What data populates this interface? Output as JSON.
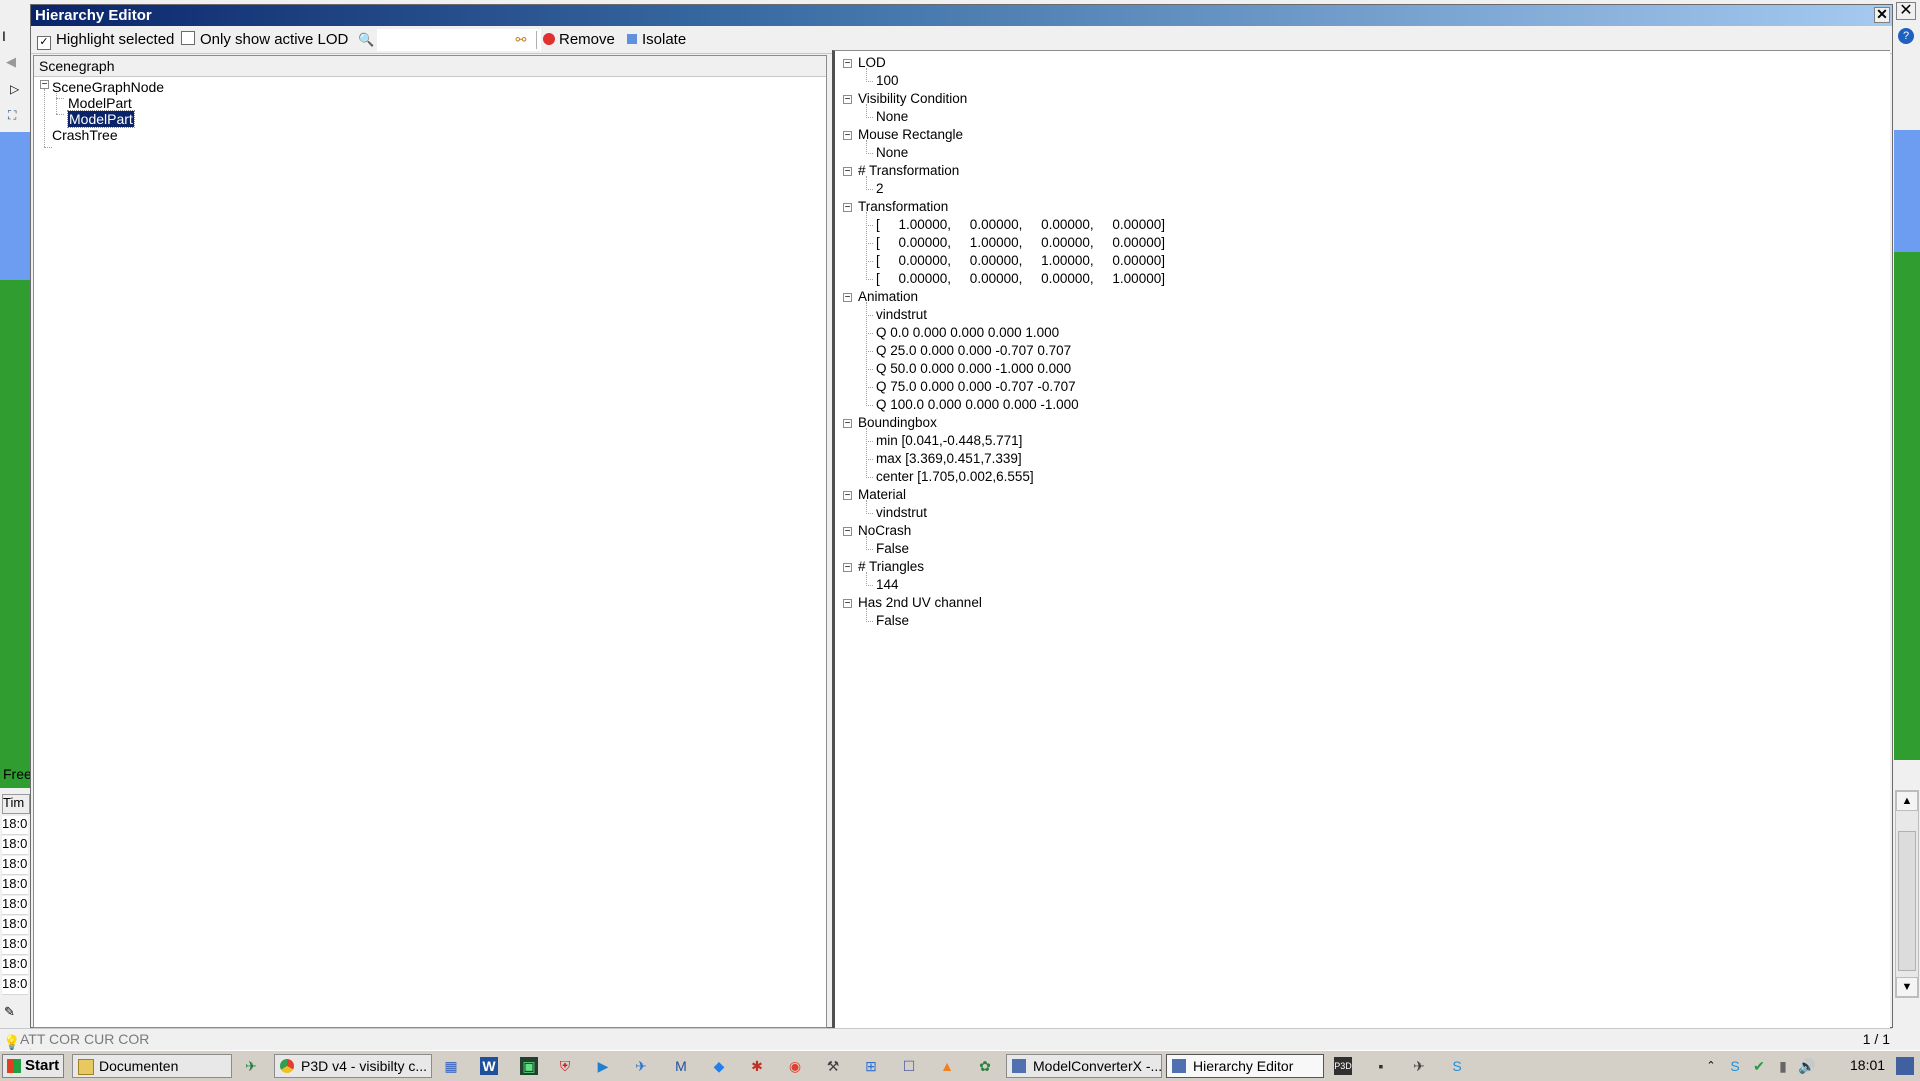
{
  "dialog": {
    "title": "Hierarchy Editor",
    "close_glyph": "✕"
  },
  "toolbar": {
    "highlight_selected": {
      "label": "Highlight selected",
      "checked": true
    },
    "only_active_lod": {
      "label": "Only show active LOD",
      "checked": false
    },
    "search_placeholder": "",
    "remove_label": "Remove",
    "isolate_label": "Isolate"
  },
  "scenegraph": {
    "header": "Scenegraph",
    "nodes": [
      {
        "label": "SceneGraphNode",
        "selected": false
      },
      {
        "label": "ModelPart",
        "selected": false
      },
      {
        "label": "ModelPart",
        "selected": true
      },
      {
        "label": "CrashTree",
        "selected": false
      }
    ]
  },
  "properties": [
    {
      "name": "LOD",
      "values": [
        "100"
      ]
    },
    {
      "name": "Visibility Condition",
      "values": [
        "None"
      ]
    },
    {
      "name": "Mouse Rectangle",
      "values": [
        "None"
      ]
    },
    {
      "name": "# Transformation",
      "values": [
        "2"
      ]
    },
    {
      "name": "Transformation",
      "values": [
        "[     1.00000,     0.00000,     0.00000,     0.00000]",
        "[     0.00000,     1.00000,     0.00000,     0.00000]",
        "[     0.00000,     0.00000,     1.00000,     0.00000]",
        "[     0.00000,     0.00000,     0.00000,     1.00000]"
      ]
    },
    {
      "name": "Animation",
      "values": [
        "vindstrut",
        "Q 0.0 0.000 0.000 0.000 1.000",
        "Q 25.0 0.000 0.000 -0.707 0.707",
        "Q 50.0 0.000 0.000 -1.000 0.000",
        "Q 75.0 0.000 0.000 -0.707 -0.707",
        "Q 100.0 0.000 0.000 0.000 -1.000"
      ]
    },
    {
      "name": "Boundingbox",
      "values": [
        "min [0.041,-0.448,5.771]",
        "max [3.369,0.451,7.339]",
        "center [1.705,0.002,6.555]"
      ]
    },
    {
      "name": "Material",
      "values": [
        "vindstrut"
      ]
    },
    {
      "name": "NoCrash",
      "values": [
        "False"
      ]
    },
    {
      "name": "# Triangles",
      "values": [
        "144"
      ]
    },
    {
      "name": "Has 2nd UV channel",
      "values": [
        "False"
      ]
    }
  ],
  "statusbar": {
    "left_text": "ATT  COR  CUR  COR",
    "page": "1 / 1"
  },
  "background_app": {
    "partial_label_top": "I",
    "partial_label_free": "Free",
    "partial_col_header": "Tim",
    "time_cells": [
      "18:0",
      "18:0",
      "18:0",
      "18:0",
      "18:0",
      "18:0",
      "18:0",
      "18:0",
      "18:0"
    ]
  },
  "taskbar": {
    "start_label": "Start",
    "buttons": [
      {
        "label": "Documenten",
        "icon": "folder-icon"
      },
      {
        "label": "P3D v4 - visibilty c...",
        "icon": "chrome-icon"
      },
      {
        "label": "ModelConverterX -...",
        "icon": "modelconverter-icon"
      },
      {
        "label": "Hierarchy Editor",
        "icon": "hierarchy-icon",
        "active": true
      }
    ],
    "clock": "18:01"
  },
  "colors": {
    "title_gradient_start": "#0a246a",
    "selection": "#0a246a",
    "bg_green": "#2f9d2f",
    "bg_blue": "#6d9df0"
  }
}
